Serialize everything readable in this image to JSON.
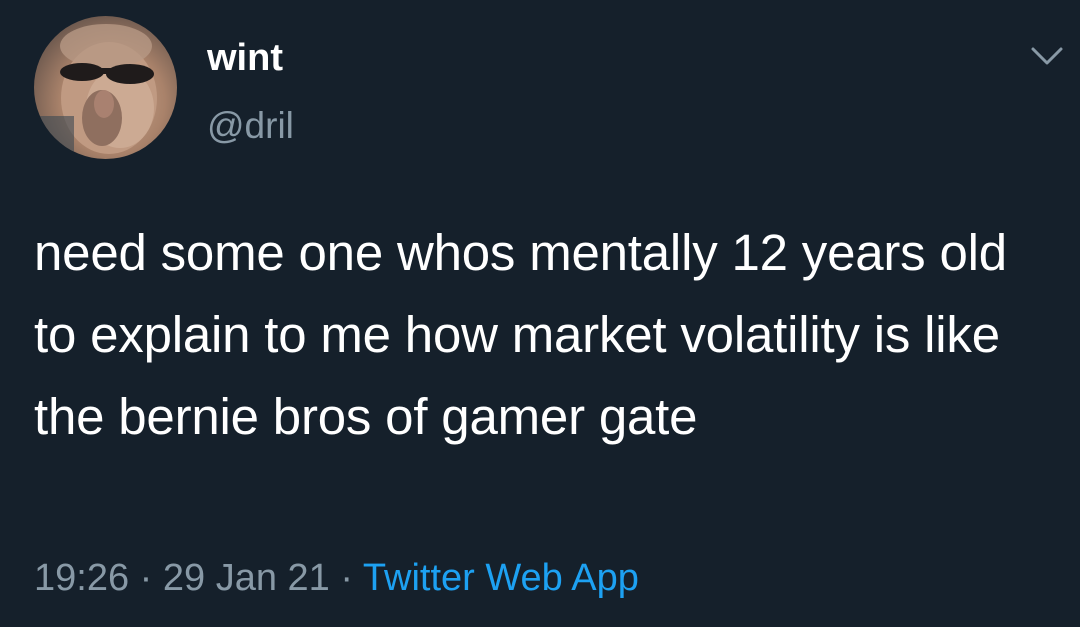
{
  "tweet": {
    "display_name": "wint",
    "handle": "@dril",
    "text": "need some one whos mentally 12 years old to explain to me how market volatility is like the bernie bros of gamer gate",
    "time": "19:26",
    "separator_1": "·",
    "date": "29 Jan 21",
    "separator_2": "·",
    "source": "Twitter Web App",
    "menu_icon": "chevron-down-icon",
    "avatar_icon": "avatar"
  },
  "colors": {
    "background": "#15202b",
    "primary_text": "#ffffff",
    "secondary_text": "#8899a6",
    "link": "#1da1f2"
  }
}
